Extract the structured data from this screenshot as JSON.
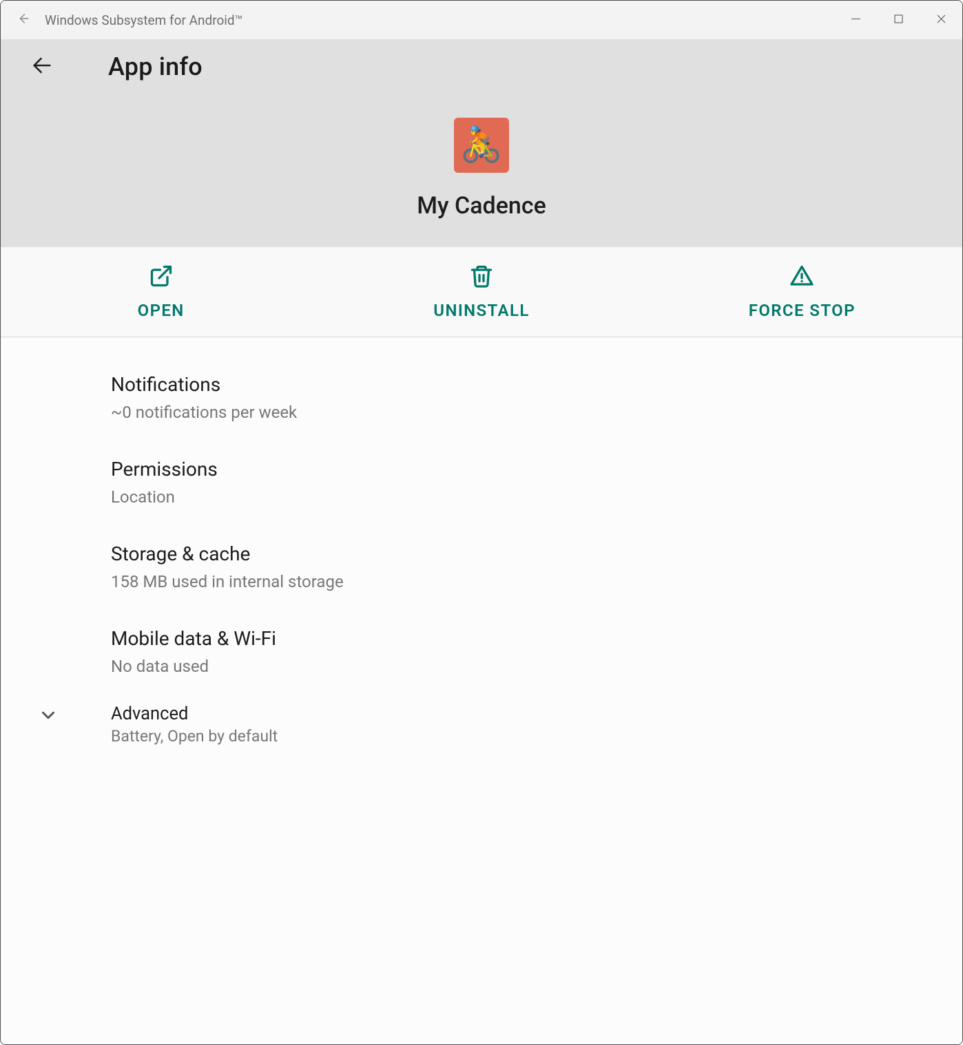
{
  "window": {
    "title": "Windows Subsystem for Android™"
  },
  "page_title": "App info",
  "app": {
    "name": "My Cadence",
    "icon_emoji": "🚴"
  },
  "actions": {
    "open": "OPEN",
    "uninstall": "UNINSTALL",
    "force_stop": "FORCE STOP"
  },
  "settings": {
    "notifications": {
      "title": "Notifications",
      "subtitle": "~0 notifications per week"
    },
    "permissions": {
      "title": "Permissions",
      "subtitle": "Location"
    },
    "storage": {
      "title": "Storage & cache",
      "subtitle": "158 MB used in internal storage"
    },
    "data": {
      "title": "Mobile data & Wi-Fi",
      "subtitle": "No data used"
    },
    "advanced": {
      "title": "Advanced",
      "subtitle": "Battery, Open by default"
    }
  },
  "colors": {
    "accent": "#00796b"
  }
}
